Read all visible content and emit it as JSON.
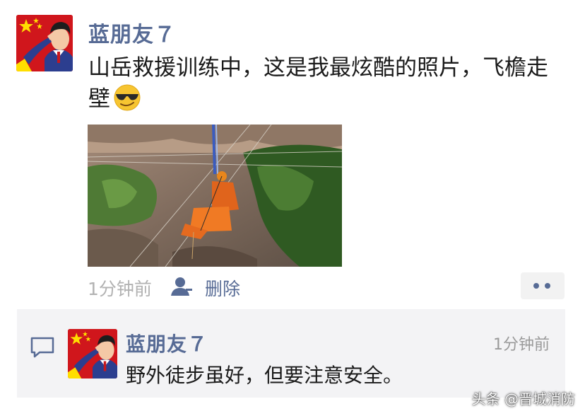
{
  "post": {
    "author": "蓝朋友７",
    "text": "山岳救援训练中，这是我最炫酷的照片，飞檐走壁",
    "emoji": "sunglasses-face",
    "time": "1分钟前",
    "delete_label": "删除"
  },
  "comment": {
    "author": "蓝朋友７",
    "time": "1分钟前",
    "text": "野外徒步虽好，但要注意安全。"
  },
  "watermark": "头条 @晋城消防",
  "colors": {
    "name": "#576b95",
    "text": "#1a1a1a",
    "meta": "#b2b2b2",
    "comment_bg": "#f3f3f5"
  }
}
